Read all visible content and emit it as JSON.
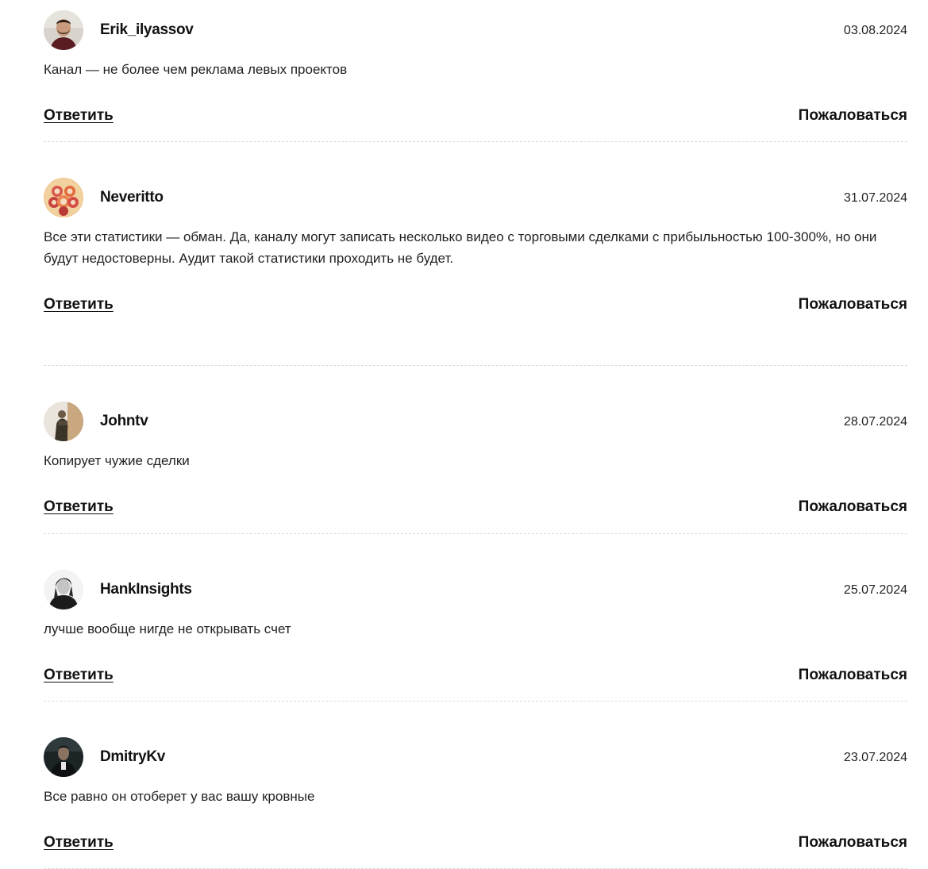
{
  "comments": [
    {
      "username": "Erik_ilyassov",
      "date": "03.08.2024",
      "text": "Канал — не более чем реклама левых проектов",
      "reply_label": "Ответить",
      "report_label": "Пожаловаться",
      "avatar_icon": "user-photo-icon"
    },
    {
      "username": "Neveritto",
      "date": "31.07.2024",
      "text": "Все эти статистики — обман. Да, каналу могут записать несколько видео с торговыми сделками с прибыльностью 100-300%, но они будут недостоверны. Аудит такой статистики проходить не будет.",
      "reply_label": "Ответить",
      "report_label": "Пожаловаться",
      "avatar_icon": "illustrated-faces-icon"
    },
    {
      "username": "Johntv",
      "date": "28.07.2024",
      "text": "Копирует чужие сделки",
      "reply_label": "Ответить",
      "report_label": "Пожаловаться",
      "avatar_icon": "user-photo-icon"
    },
    {
      "username": "HankInsights",
      "date": "25.07.2024",
      "text": "лучше вообще нигде не открывать счет",
      "reply_label": "Ответить",
      "report_label": "Пожаловаться",
      "avatar_icon": "user-photo-icon"
    },
    {
      "username": "DmitryKv",
      "date": "23.07.2024",
      "text": "Все равно он отоберет у вас вашу кровные",
      "reply_label": "Ответить",
      "report_label": "Пожаловаться",
      "avatar_icon": "user-photo-icon"
    }
  ]
}
